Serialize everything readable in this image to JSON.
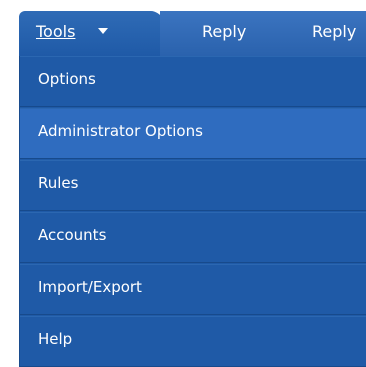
{
  "toolbar": {
    "tabs": {
      "tools": "Tools"
    },
    "buttons": {
      "reply_1": "Reply",
      "reply_2": "Reply"
    },
    "accent_color": "#1f5aa7"
  },
  "menu": {
    "items": [
      {
        "label": "Options"
      },
      {
        "label": "Administrator Options"
      },
      {
        "label": "Rules"
      },
      {
        "label": "Accounts"
      },
      {
        "label": "Import/Export"
      },
      {
        "label": "Help"
      }
    ],
    "selected_item": "Administrator Options"
  }
}
